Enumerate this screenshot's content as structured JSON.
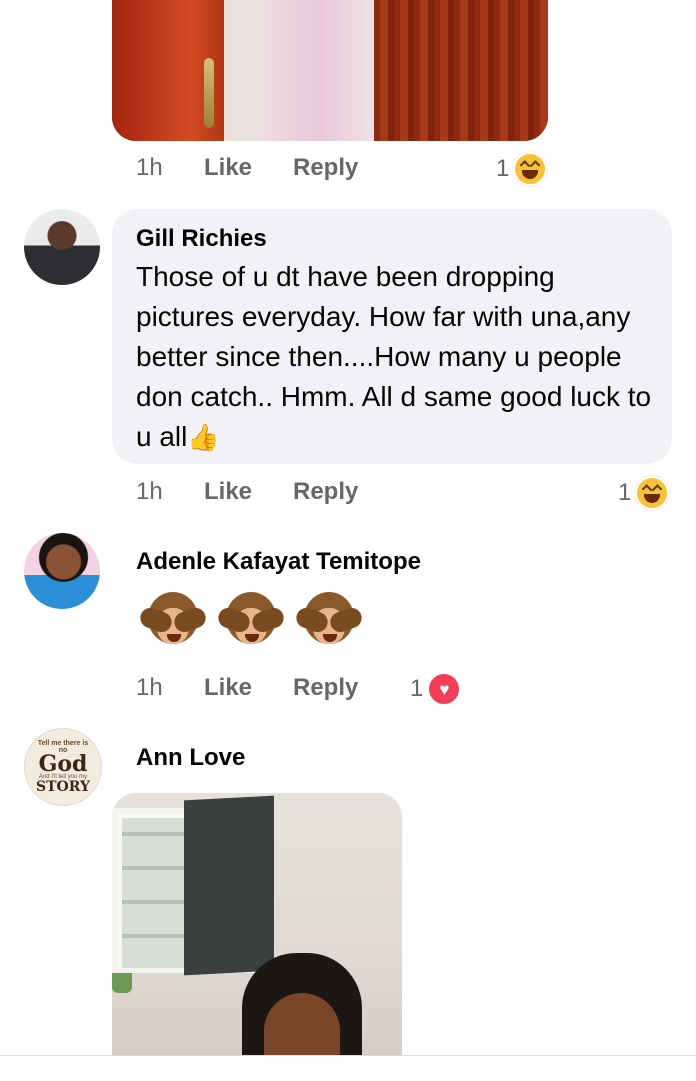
{
  "comments": [
    {
      "id": "c0",
      "actions": {
        "time": "1h",
        "like": "Like",
        "reply": "Reply"
      },
      "reaction": {
        "count": "1",
        "icon": "laugh-emoji"
      }
    },
    {
      "id": "c1",
      "author": "Gill Richies",
      "text": "Those of u dt have been dropping pictures everyday. How far with una,any better since then....How many u people don catch.. Hmm. All d same good luck to u all",
      "trailing_emoji": "thumbs-up-emoji",
      "actions": {
        "time": "1h",
        "like": "Like",
        "reply": "Reply"
      },
      "reaction": {
        "count": "1",
        "icon": "laugh-emoji"
      }
    },
    {
      "id": "c2",
      "author": "Adenle Kafayat Temitope",
      "emojis": [
        "see-no-evil-monkey-emoji",
        "see-no-evil-monkey-emoji",
        "see-no-evil-monkey-emoji"
      ],
      "actions": {
        "time": "1h",
        "like": "Like",
        "reply": "Reply"
      },
      "reaction": {
        "count": "1",
        "icon": "heart-reaction",
        "color": "#f33e58"
      }
    },
    {
      "id": "c3",
      "author": "Ann Love",
      "avatar_text": {
        "line1": "Tell me there is",
        "line2": "no",
        "line3": "God",
        "line4": "And I'll tell you my",
        "line5": "STORY"
      }
    }
  ]
}
